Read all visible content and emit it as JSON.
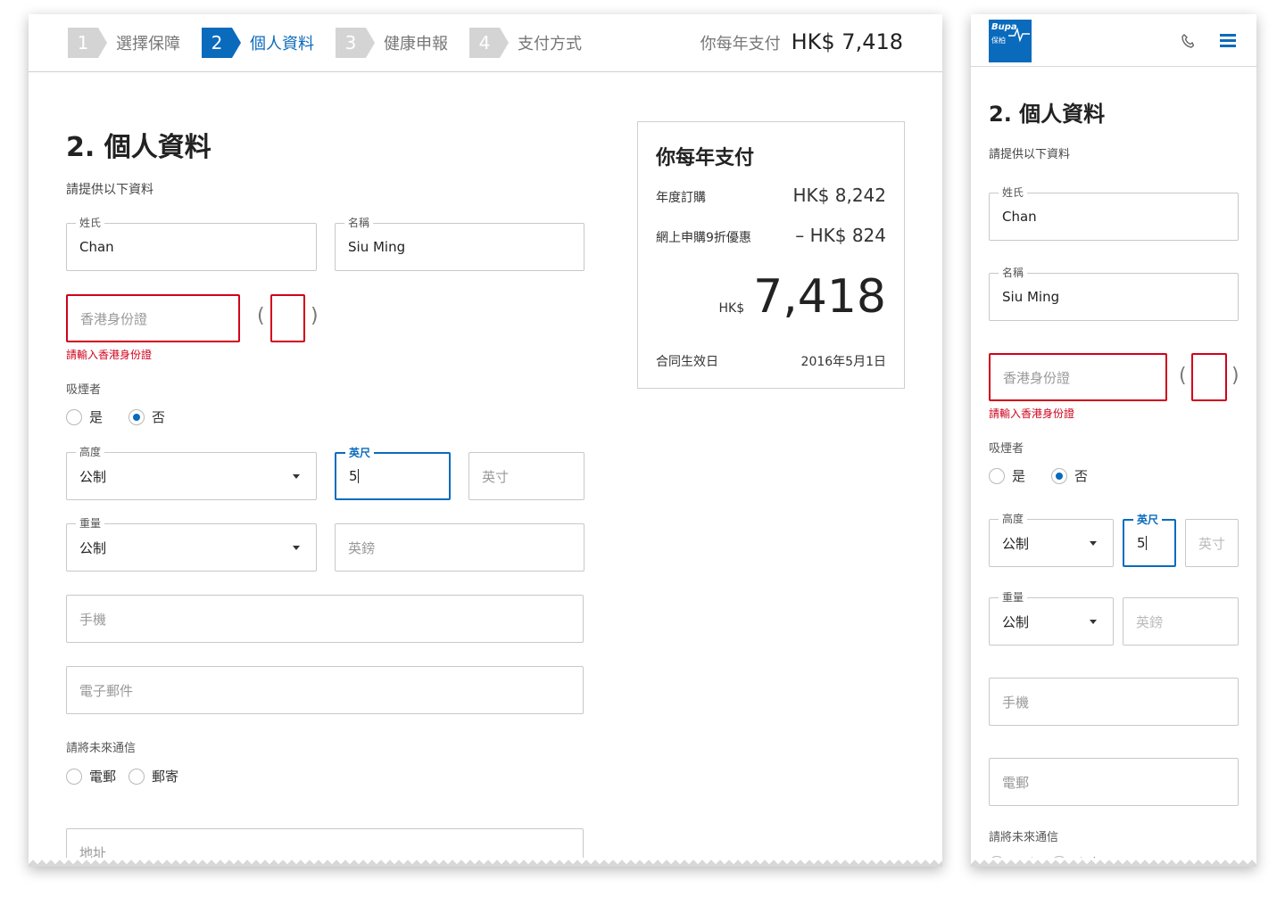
{
  "steps": [
    {
      "num": "1",
      "label": "選擇保障"
    },
    {
      "num": "2",
      "label": "個人資料"
    },
    {
      "num": "3",
      "label": "健康申報"
    },
    {
      "num": "4",
      "label": "支付方式"
    }
  ],
  "header": {
    "pay_label": "你每年支付",
    "pay_value": "HK$ 7,418"
  },
  "form": {
    "title": "2. 個人資料",
    "subtitle": "請提供以下資料",
    "surname": {
      "label": "姓氏",
      "value": "Chan"
    },
    "given_name": {
      "label": "名稱",
      "value": "Siu Ming"
    },
    "hkid": {
      "placeholder": "香港身份證",
      "open": "(",
      "close": ")",
      "error": "請輸入香港身份證"
    },
    "smoker": {
      "label": "吸煙者",
      "yes": "是",
      "no": "否"
    },
    "height": {
      "label": "高度",
      "unit": "公制",
      "feet_label": "英尺",
      "feet_value": "5",
      "inch_placeholder": "英寸"
    },
    "weight": {
      "label": "重量",
      "unit": "公制",
      "lb_placeholder": "英鎊"
    },
    "mobile_placeholder": "手機",
    "email_placeholder": "電子郵件",
    "email_placeholder_mobile": "電郵",
    "contact": {
      "label": "請將未來通信",
      "email": "電郵",
      "post": "郵寄"
    },
    "address_placeholder": "地址"
  },
  "summary": {
    "title": "你每年支付",
    "annual_label": "年度訂購",
    "annual_value": "HK$ 8,242",
    "discount_label": "網上申購9折優惠",
    "discount_value": "– HK$ 824",
    "currency": "HK$",
    "total": "7,418",
    "effective_label": "合同生效日",
    "effective_value": "2016年5月1日"
  },
  "mobile": {
    "logo_en": "Bupa",
    "logo_zh": "保柏",
    "phone_icon": "phone-icon",
    "menu_icon": "hamburger-menu-icon"
  },
  "colors": {
    "accent": "#0a6bbd",
    "error": "#d0021b"
  }
}
